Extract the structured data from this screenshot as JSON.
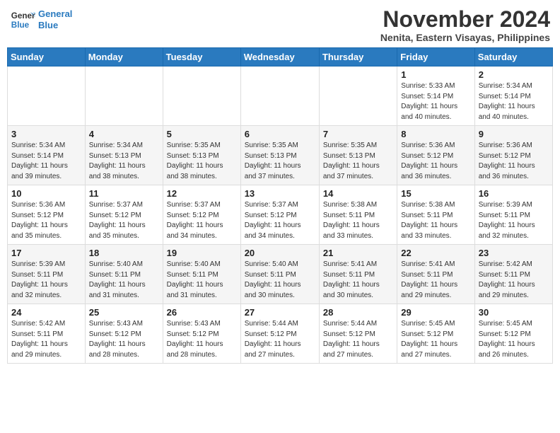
{
  "header": {
    "logo_line1": "General",
    "logo_line2": "Blue",
    "month": "November 2024",
    "location": "Nenita, Eastern Visayas, Philippines"
  },
  "weekdays": [
    "Sunday",
    "Monday",
    "Tuesday",
    "Wednesday",
    "Thursday",
    "Friday",
    "Saturday"
  ],
  "weeks": [
    [
      {
        "day": "",
        "info": ""
      },
      {
        "day": "",
        "info": ""
      },
      {
        "day": "",
        "info": ""
      },
      {
        "day": "",
        "info": ""
      },
      {
        "day": "",
        "info": ""
      },
      {
        "day": "1",
        "info": "Sunrise: 5:33 AM\nSunset: 5:14 PM\nDaylight: 11 hours\nand 40 minutes."
      },
      {
        "day": "2",
        "info": "Sunrise: 5:34 AM\nSunset: 5:14 PM\nDaylight: 11 hours\nand 40 minutes."
      }
    ],
    [
      {
        "day": "3",
        "info": "Sunrise: 5:34 AM\nSunset: 5:14 PM\nDaylight: 11 hours\nand 39 minutes."
      },
      {
        "day": "4",
        "info": "Sunrise: 5:34 AM\nSunset: 5:13 PM\nDaylight: 11 hours\nand 38 minutes."
      },
      {
        "day": "5",
        "info": "Sunrise: 5:35 AM\nSunset: 5:13 PM\nDaylight: 11 hours\nand 38 minutes."
      },
      {
        "day": "6",
        "info": "Sunrise: 5:35 AM\nSunset: 5:13 PM\nDaylight: 11 hours\nand 37 minutes."
      },
      {
        "day": "7",
        "info": "Sunrise: 5:35 AM\nSunset: 5:13 PM\nDaylight: 11 hours\nand 37 minutes."
      },
      {
        "day": "8",
        "info": "Sunrise: 5:36 AM\nSunset: 5:12 PM\nDaylight: 11 hours\nand 36 minutes."
      },
      {
        "day": "9",
        "info": "Sunrise: 5:36 AM\nSunset: 5:12 PM\nDaylight: 11 hours\nand 36 minutes."
      }
    ],
    [
      {
        "day": "10",
        "info": "Sunrise: 5:36 AM\nSunset: 5:12 PM\nDaylight: 11 hours\nand 35 minutes."
      },
      {
        "day": "11",
        "info": "Sunrise: 5:37 AM\nSunset: 5:12 PM\nDaylight: 11 hours\nand 35 minutes."
      },
      {
        "day": "12",
        "info": "Sunrise: 5:37 AM\nSunset: 5:12 PM\nDaylight: 11 hours\nand 34 minutes."
      },
      {
        "day": "13",
        "info": "Sunrise: 5:37 AM\nSunset: 5:12 PM\nDaylight: 11 hours\nand 34 minutes."
      },
      {
        "day": "14",
        "info": "Sunrise: 5:38 AM\nSunset: 5:11 PM\nDaylight: 11 hours\nand 33 minutes."
      },
      {
        "day": "15",
        "info": "Sunrise: 5:38 AM\nSunset: 5:11 PM\nDaylight: 11 hours\nand 33 minutes."
      },
      {
        "day": "16",
        "info": "Sunrise: 5:39 AM\nSunset: 5:11 PM\nDaylight: 11 hours\nand 32 minutes."
      }
    ],
    [
      {
        "day": "17",
        "info": "Sunrise: 5:39 AM\nSunset: 5:11 PM\nDaylight: 11 hours\nand 32 minutes."
      },
      {
        "day": "18",
        "info": "Sunrise: 5:40 AM\nSunset: 5:11 PM\nDaylight: 11 hours\nand 31 minutes."
      },
      {
        "day": "19",
        "info": "Sunrise: 5:40 AM\nSunset: 5:11 PM\nDaylight: 11 hours\nand 31 minutes."
      },
      {
        "day": "20",
        "info": "Sunrise: 5:40 AM\nSunset: 5:11 PM\nDaylight: 11 hours\nand 30 minutes."
      },
      {
        "day": "21",
        "info": "Sunrise: 5:41 AM\nSunset: 5:11 PM\nDaylight: 11 hours\nand 30 minutes."
      },
      {
        "day": "22",
        "info": "Sunrise: 5:41 AM\nSunset: 5:11 PM\nDaylight: 11 hours\nand 29 minutes."
      },
      {
        "day": "23",
        "info": "Sunrise: 5:42 AM\nSunset: 5:11 PM\nDaylight: 11 hours\nand 29 minutes."
      }
    ],
    [
      {
        "day": "24",
        "info": "Sunrise: 5:42 AM\nSunset: 5:11 PM\nDaylight: 11 hours\nand 29 minutes."
      },
      {
        "day": "25",
        "info": "Sunrise: 5:43 AM\nSunset: 5:12 PM\nDaylight: 11 hours\nand 28 minutes."
      },
      {
        "day": "26",
        "info": "Sunrise: 5:43 AM\nSunset: 5:12 PM\nDaylight: 11 hours\nand 28 minutes."
      },
      {
        "day": "27",
        "info": "Sunrise: 5:44 AM\nSunset: 5:12 PM\nDaylight: 11 hours\nand 27 minutes."
      },
      {
        "day": "28",
        "info": "Sunrise: 5:44 AM\nSunset: 5:12 PM\nDaylight: 11 hours\nand 27 minutes."
      },
      {
        "day": "29",
        "info": "Sunrise: 5:45 AM\nSunset: 5:12 PM\nDaylight: 11 hours\nand 27 minutes."
      },
      {
        "day": "30",
        "info": "Sunrise: 5:45 AM\nSunset: 5:12 PM\nDaylight: 11 hours\nand 26 minutes."
      }
    ]
  ]
}
